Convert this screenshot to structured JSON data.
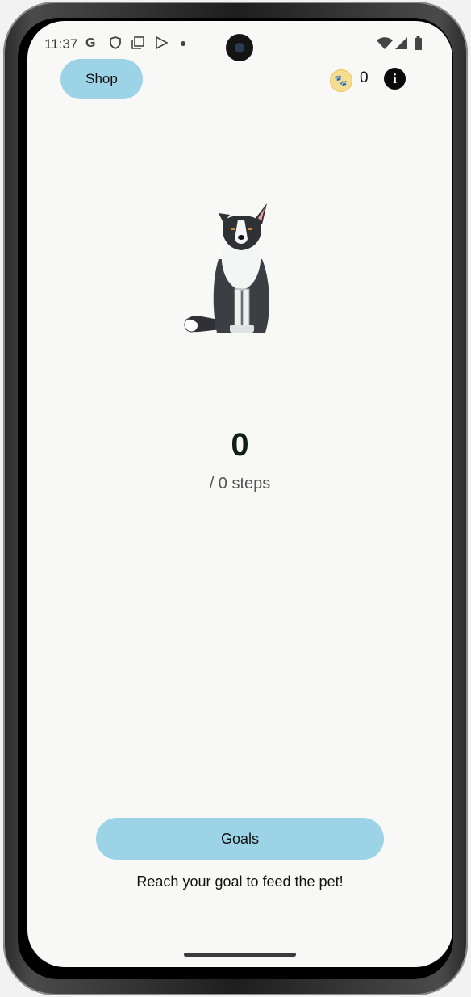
{
  "status_bar": {
    "time": "11:37",
    "left_icons": [
      "google-g-icon",
      "shield-icon",
      "copy-icon",
      "play-store-icon",
      "dot-icon"
    ],
    "right_icons": [
      "wifi-icon",
      "signal-icon",
      "battery-icon"
    ]
  },
  "header": {
    "shop_label": "Shop",
    "coin_count": "0",
    "coin_icon": "paw-coin-icon",
    "info_icon": "info-icon"
  },
  "pet": {
    "icon": "dog-sprite"
  },
  "steps": {
    "current": "0",
    "goal_text": "/ 0 steps"
  },
  "footer": {
    "goals_label": "Goals",
    "hint": "Reach your goal to feed the pet!"
  },
  "colors": {
    "accent": "#9cd3e6",
    "background": "#f8f9f6"
  }
}
